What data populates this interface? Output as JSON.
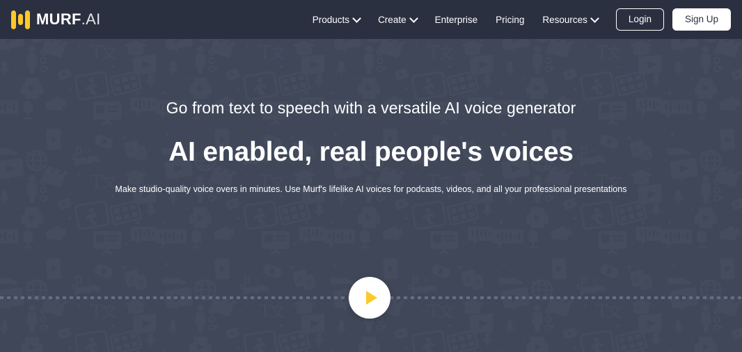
{
  "header": {
    "logo": {
      "icon": "murf-waveform-logo",
      "name_bold": "MURF",
      "name_light": ".AI",
      "accent_color": "#fdc92a"
    },
    "nav_items": [
      {
        "label": "Products",
        "has_dropdown": true,
        "icon": "chevron-down-icon"
      },
      {
        "label": "Create",
        "has_dropdown": true,
        "icon": "chevron-down-icon"
      },
      {
        "label": "Enterprise",
        "has_dropdown": false,
        "icon": ""
      },
      {
        "label": "Pricing",
        "has_dropdown": false,
        "icon": ""
      },
      {
        "label": "Resources",
        "has_dropdown": true,
        "icon": "chevron-down-icon"
      }
    ],
    "login_label": "Login",
    "signup_label": "Sign Up",
    "background_color": "#2b3040"
  },
  "hero": {
    "eyebrow": "Go from text to speech with a versatile AI voice generator",
    "headline": "AI enabled, real people's voices",
    "subline": "Make studio-quality voice overs in minutes. Use Murf's lifelike AI voices for podcasts, videos, and all your professional presentations",
    "background_color": "#3f4759",
    "pattern_color": "#49506278",
    "play_button": {
      "icon": "play-icon",
      "circle_color": "#ffffff",
      "glyph_color": "#fdc92a"
    },
    "track_color": "#666d80"
  }
}
